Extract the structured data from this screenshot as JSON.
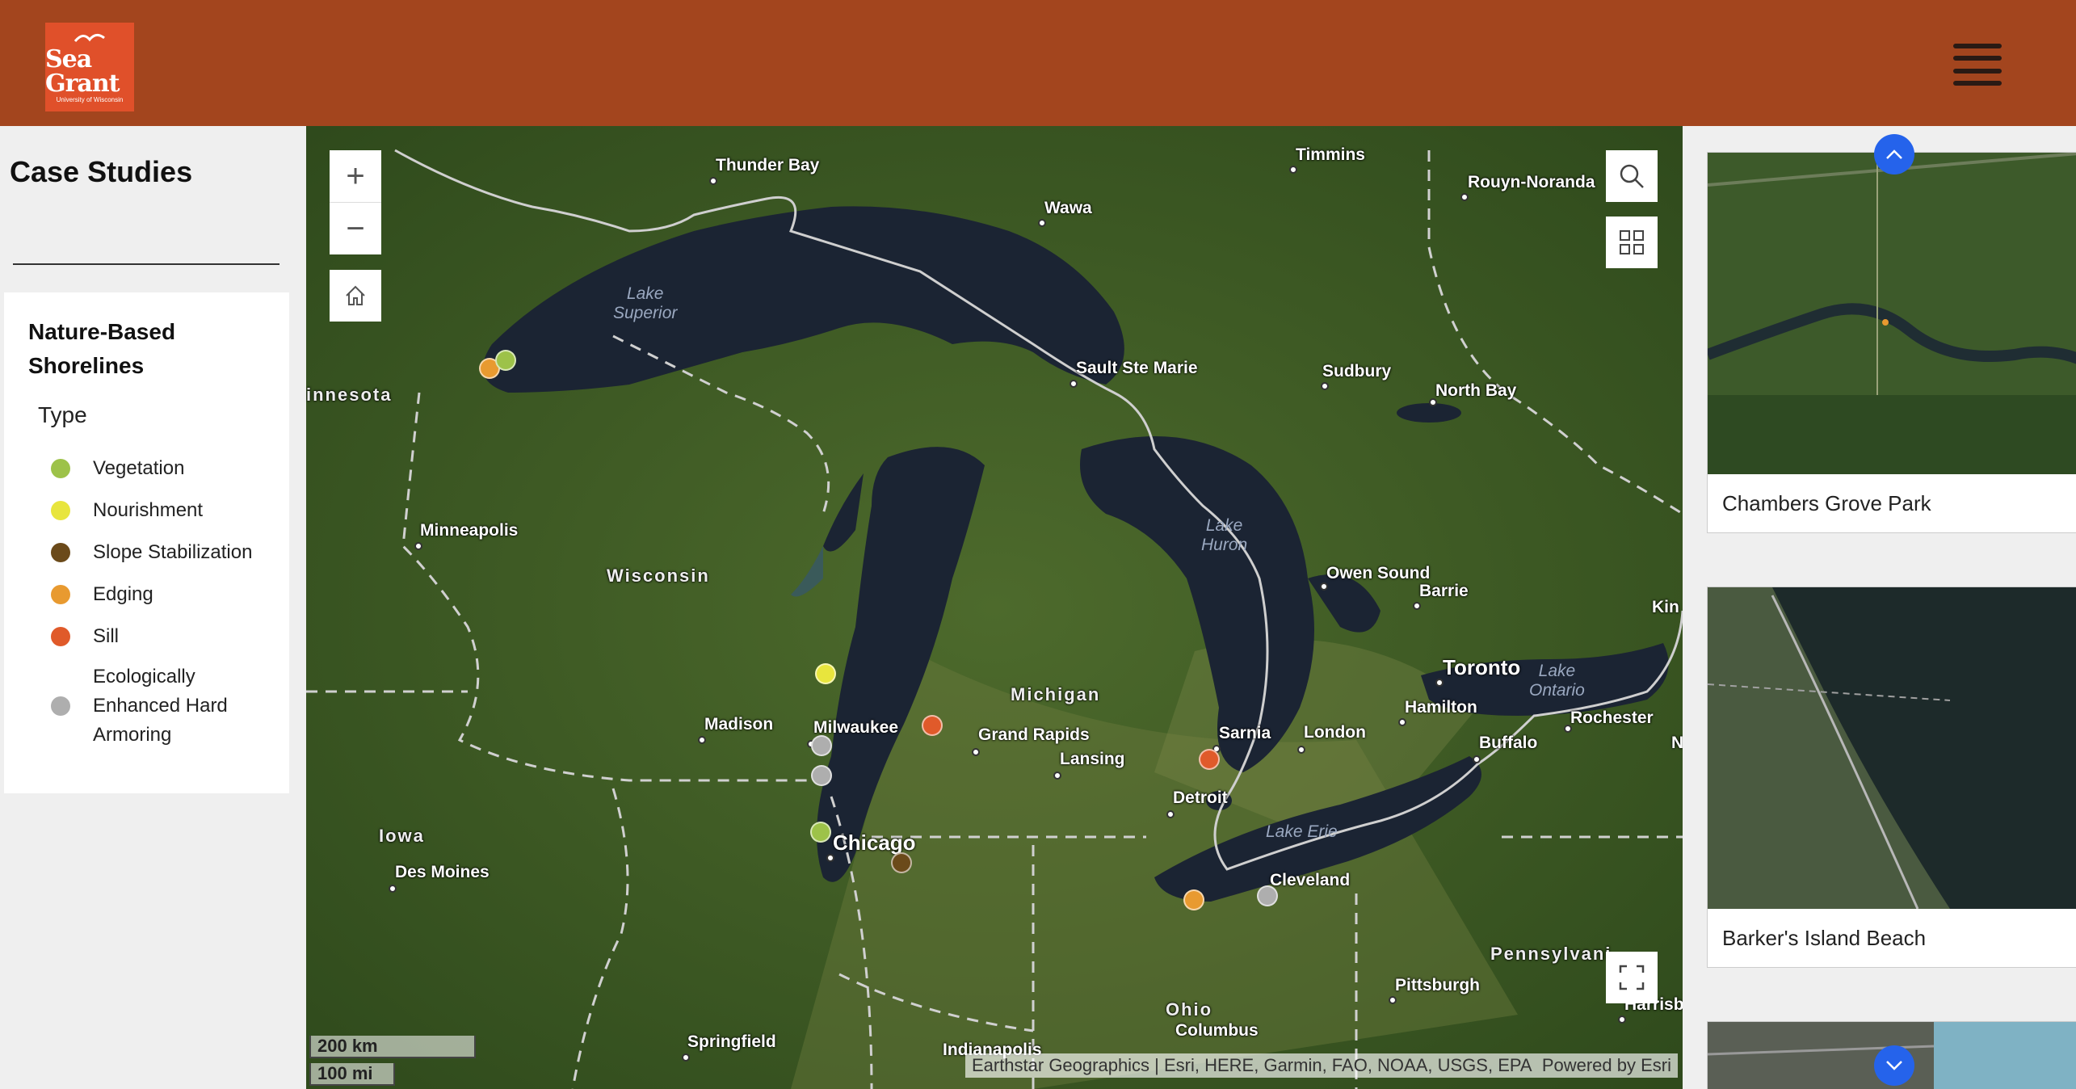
{
  "header": {
    "logo_main": "Sea Grant",
    "logo_sub": "University of Wisconsin",
    "menu_icon": "hamburger-menu-icon",
    "background": "#a3451e"
  },
  "sidebar": {
    "title": "Case Studies",
    "legend": {
      "title": "Nature-Based Shorelines",
      "type_label": "Type",
      "items": [
        {
          "label": "Vegetation",
          "color": "#9dc249"
        },
        {
          "label": "Nourishment",
          "color": "#e8e53d"
        },
        {
          "label": "Slope Stabilization",
          "color": "#6b4a1a"
        },
        {
          "label": "Edging",
          "color": "#e89a30"
        },
        {
          "label": "Sill",
          "color": "#e05a2a"
        },
        {
          "label": "Ecologically Enhanced Hard Armoring",
          "color": "#aeaeae"
        }
      ]
    }
  },
  "map": {
    "labels": {
      "thunder_bay": "Thunder Bay",
      "timmins": "Timmins",
      "rouyn": "Rouyn-Noranda",
      "wawa": "Wawa",
      "minnesota": "innesota",
      "sault": "Sault Ste Marie",
      "sudbury": "Sudbury",
      "north_bay": "North Bay",
      "minneapolis": "Minneapolis",
      "wisconsin": "Wisconsin",
      "owen_sound": "Owen Sound",
      "barrie": "Barrie",
      "kingston": "Kin",
      "toronto": "Toronto",
      "michigan": "Michigan",
      "hamilton": "Hamilton",
      "rochester": "Rochester",
      "madison": "Madison",
      "milwaukee": "Milwaukee",
      "grand_rapids": "Grand Rapids",
      "sarnia": "Sarnia",
      "london": "London",
      "buffalo": "Buffalo",
      "ny": "N",
      "lansing": "Lansing",
      "detroit": "Detroit",
      "iowa": "Iowa",
      "chicago": "Chicago",
      "des_moines": "Des Moines",
      "cleveland": "Cleveland",
      "pennsylvania": "Pennsylvani",
      "pittsburgh": "Pittsburgh",
      "harrisburg": "Harrisb",
      "ohio": "Ohio",
      "columbus": "Columbus",
      "springfield": "Springfield",
      "indianapolis": "Indianapolis"
    },
    "lakes": {
      "superior_1": "Lake",
      "superior_2": "Superior",
      "huron_1": "Lake",
      "huron_2": "Huron",
      "erie": "Lake Erie",
      "ontario_1": "Lake",
      "ontario_2": "Ontario"
    },
    "scale_km": "200 km",
    "scale_mi": "100 mi",
    "attribution": "Earthstar Geographics | Esri, HERE, Garmin, FAO, NOAA, USGS, EPA",
    "powered_by": "Powered by Esri",
    "controls": {
      "zoom_in": "+",
      "zoom_out": "−",
      "home_icon": "home-icon",
      "search_icon": "search-icon",
      "basemap_icon": "basemap-gallery-icon",
      "fullscreen_icon": "fullscreen-icon"
    }
  },
  "case_cards": [
    {
      "title": "Chambers Grove Park"
    },
    {
      "title": "Barker's Island Beach"
    }
  ]
}
